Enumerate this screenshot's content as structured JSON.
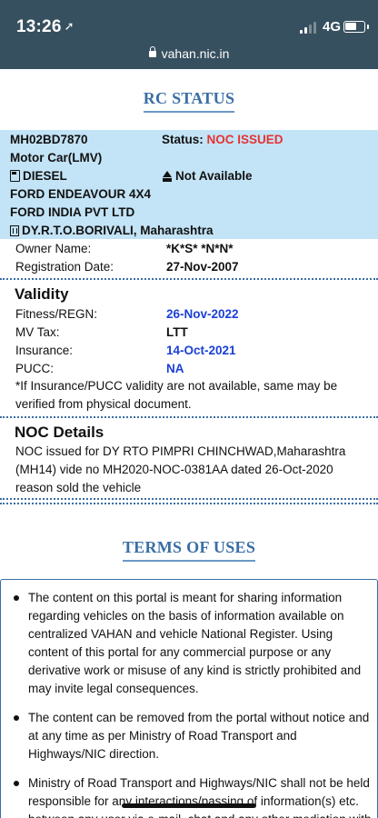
{
  "status_bar": {
    "time": "13:26",
    "network": "4G",
    "url": "vahan.nic.in"
  },
  "rc_status": {
    "heading": "RC STATUS",
    "reg_no": "MH02BD7870",
    "status_label": "Status:",
    "status_value": "NOC ISSUED",
    "vehicle_class": "Motor Car(LMV)",
    "fuel": "DIESEL",
    "emission": "Not Available",
    "model": "FORD ENDEAVOUR 4X4",
    "maker": "FORD INDIA PVT LTD",
    "rto": "DY.R.T.O.BORIVALI, Maharashtra",
    "owner_label": "Owner Name:",
    "owner_value": "*K*S* *N*N*",
    "reg_date_label": "Registration Date:",
    "reg_date_value": "27-Nov-2007"
  },
  "validity": {
    "title": "Validity",
    "rows": [
      {
        "label": "Fitness/REGN:",
        "value": "26-Nov-2022"
      },
      {
        "label": "MV Tax:",
        "value": "LTT"
      },
      {
        "label": "Insurance:",
        "value": "14-Oct-2021"
      },
      {
        "label": "PUCC:",
        "value": "NA"
      }
    ],
    "note": "*If Insurance/PUCC validity are not available, same may be verified from physical document."
  },
  "noc": {
    "title": "NOC Details",
    "text": "NOC issued for DY RTO PIMPRI CHINCHWAD,Maharashtra (MH14) vide no MH2020-NOC-0381AA dated 26-Oct-2020 reason sold the vehicle"
  },
  "terms": {
    "heading": "TERMS OF USES",
    "items": [
      "The content on this portal is meant for sharing information regarding vehicles on the basis of information available on centralized VAHAN and vehicle National Register. Using content of this portal for any commercial purpose or any derivative work or misuse of any kind is strictly prohibited and may invite legal consequences.",
      "The content can be removed from the portal without notice and at any time as per Ministry of Road Transport and Highways/NIC direction.",
      "Ministry of Road Transport and Highways/NIC shall not be held responsible for any interactions/passing of information(s) etc. between any user via e-mail, chat and any other mediation with"
    ]
  },
  "colors": {
    "header_bg": "#37505f",
    "rc_block_bg": "#c3e3f6",
    "status_red": "#e53333",
    "date_blue": "#1a3fd6",
    "heading_blue": "#3a6ea5"
  },
  "icons": [
    "location-arrow-icon",
    "signal-icon",
    "battery-icon",
    "lock-icon",
    "fuel-pump-icon",
    "emission-icon",
    "office-building-icon"
  ]
}
